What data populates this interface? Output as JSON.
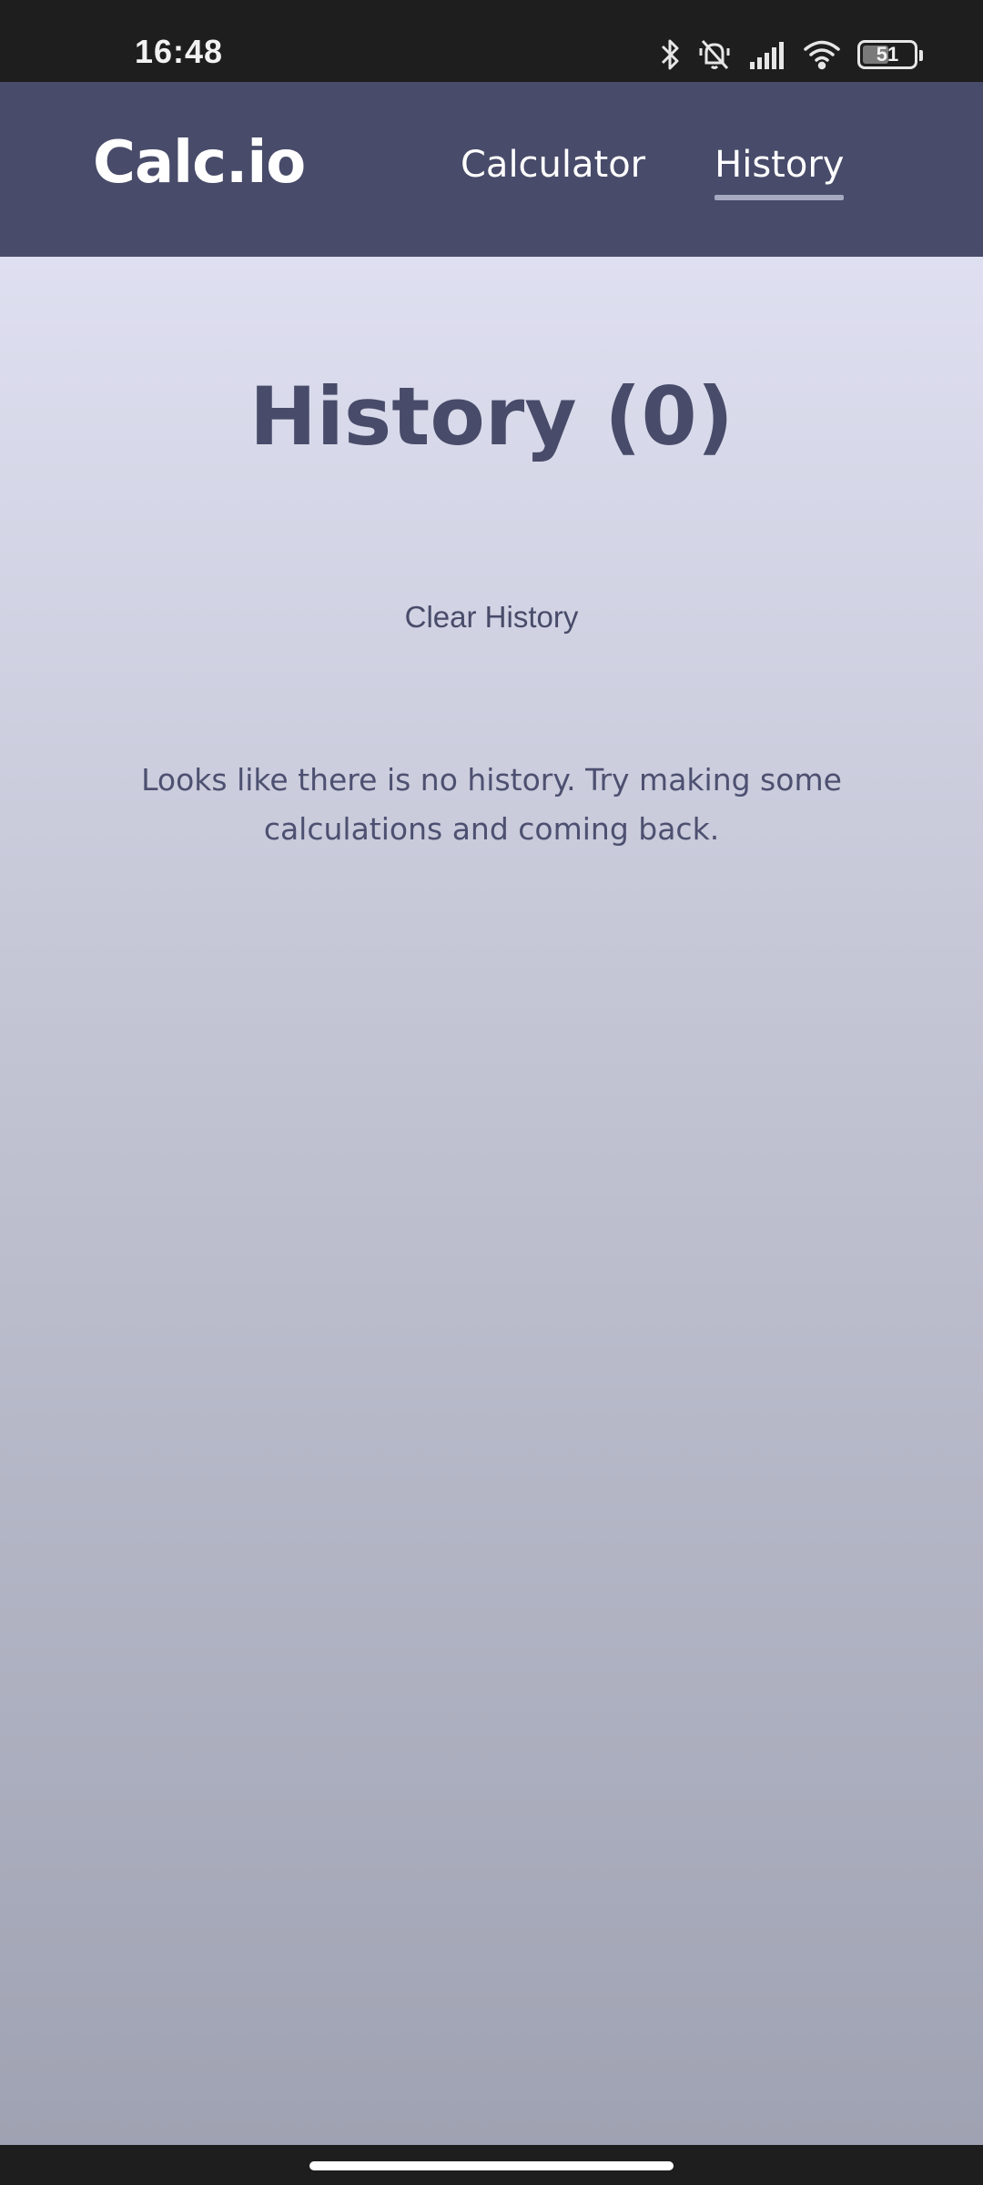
{
  "status_bar": {
    "time": "16:48",
    "icons": [
      "bluetooth-icon",
      "silent-bell-icon",
      "signal-icon",
      "wifi-icon",
      "battery-icon"
    ],
    "battery_percent": "51",
    "battery_level": 0.51
  },
  "header": {
    "brand": "Calc.io",
    "nav": [
      {
        "label": "Calculator",
        "active": false
      },
      {
        "label": "History",
        "active": true
      }
    ],
    "background_color": "#484b69"
  },
  "main": {
    "title": "History (0)",
    "clear_button_label": "Clear History",
    "empty_message": "Looks like there is no history. Try making some calculations and coming back."
  }
}
